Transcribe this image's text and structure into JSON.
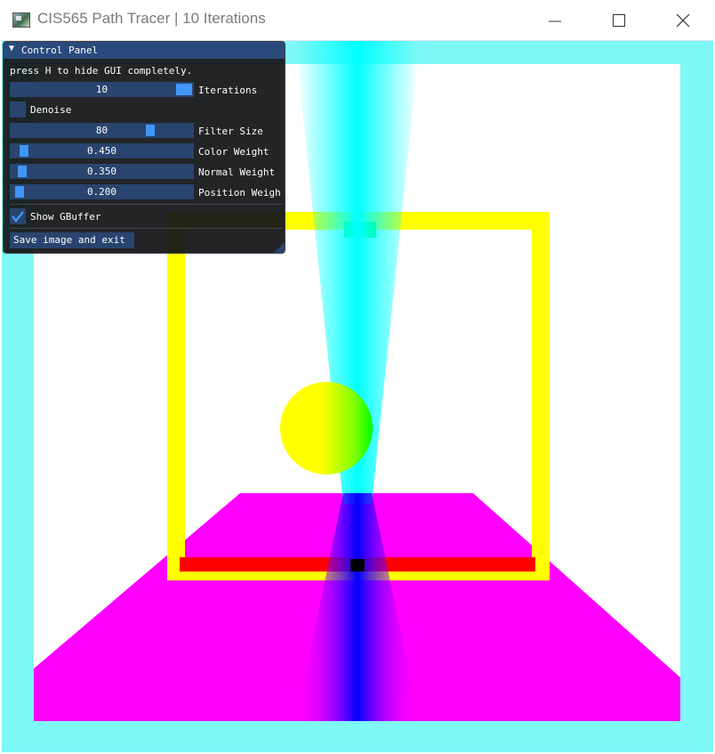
{
  "window": {
    "title": "CIS565 Path Tracer | 10 Iterations",
    "minimize_icon": "minimize-icon",
    "maximize_icon": "maximize-icon",
    "close_icon": "close-icon"
  },
  "panel": {
    "title": "Control Panel",
    "collapse_icon": "triangle-down-icon",
    "hint": "press H to hide GUI completely.",
    "sliders": [
      {
        "label": "Iterations",
        "value": "10",
        "level": 1.0
      },
      {
        "label": "Filter Size",
        "value": "80",
        "level": 0.78
      }
    ],
    "weights": [
      {
        "label": "Color Weight",
        "value": "0.450",
        "level": 0.045
      },
      {
        "label": "Normal Weight",
        "value": "0.350",
        "level": 0.035
      },
      {
        "label": "Position Weigh",
        "value": "0.200",
        "level": 0.02
      }
    ],
    "denoise": {
      "label": "Denoise",
      "checked": false
    },
    "show_gbuffer": {
      "label": "Show GBuffer",
      "checked": true
    },
    "save_button": "Save image and exit"
  },
  "colors": {
    "panel_bg": "#151618",
    "title_bg": "#294a7a",
    "widget_bg": "#29446e",
    "accent": "#4296fa",
    "scene_cyan": "#00ffff",
    "scene_yellow": "#ffff00",
    "scene_magenta": "#ff00ff",
    "scene_red": "#ff0000",
    "scene_blue": "#0000ff",
    "scene_green": "#00ff00"
  }
}
